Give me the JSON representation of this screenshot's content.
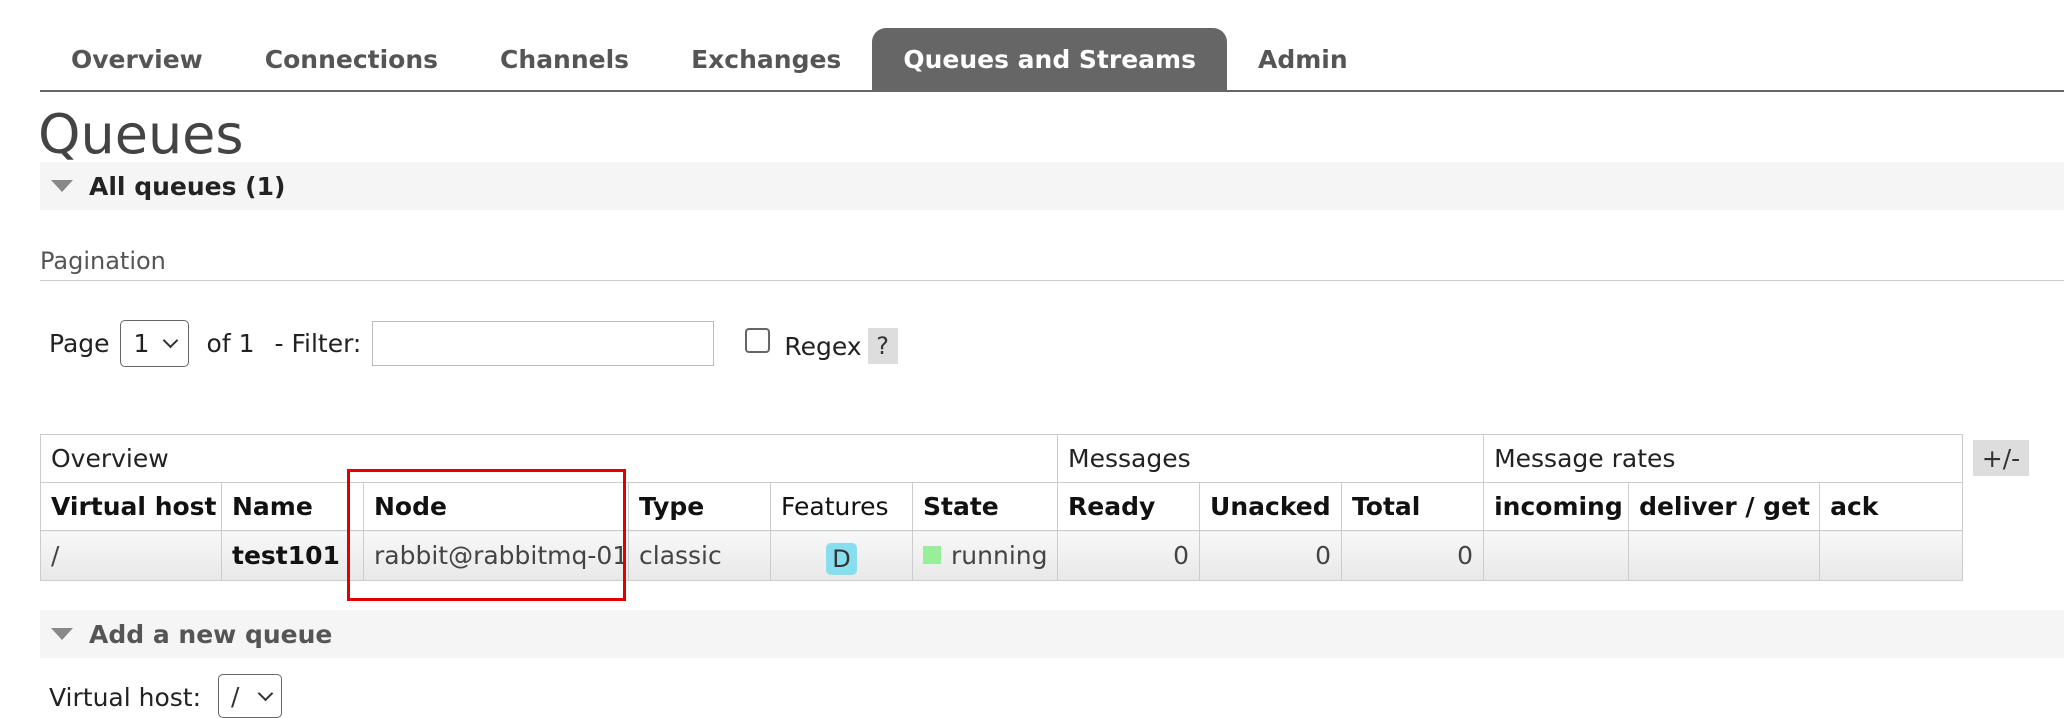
{
  "tabs": [
    {
      "label": "Overview",
      "active": false
    },
    {
      "label": "Connections",
      "active": false
    },
    {
      "label": "Channels",
      "active": false
    },
    {
      "label": "Exchanges",
      "active": false
    },
    {
      "label": "Queues and Streams",
      "active": true
    },
    {
      "label": "Admin",
      "active": false
    }
  ],
  "page_title": "Queues",
  "all_queues_section": "All queues (1)",
  "pagination": {
    "heading": "Pagination",
    "page_label": "Page",
    "page_value": "1",
    "of_label": "of 1",
    "filter_label": "- Filter:",
    "filter_value": "",
    "regex_label": "Regex",
    "regex_checked": false,
    "help_label": "?"
  },
  "table": {
    "groups": [
      "Overview",
      "Messages",
      "Message rates"
    ],
    "columns": [
      "Virtual host",
      "Name",
      "Node",
      "Type",
      "Features",
      "State",
      "Ready",
      "Unacked",
      "Total",
      "incoming",
      "deliver / get",
      "ack"
    ],
    "column_toggle": "+/-",
    "rows": [
      {
        "virtual_host": "/",
        "name": "test101",
        "node": "rabbit@rabbitmq-01",
        "type": "classic",
        "features": "D",
        "state": "running",
        "ready": "0",
        "unacked": "0",
        "total": "0",
        "incoming": "",
        "deliver_get": "",
        "ack": ""
      }
    ]
  },
  "add_queue_section": "Add a new queue",
  "add_queue_form": {
    "virtual_host_label": "Virtual host:",
    "virtual_host_value": "/"
  },
  "colors": {
    "active_tab": "#666666",
    "highlight": "#e00000",
    "feature_badge": "#88ddee",
    "running_indicator": "#99ee99"
  }
}
